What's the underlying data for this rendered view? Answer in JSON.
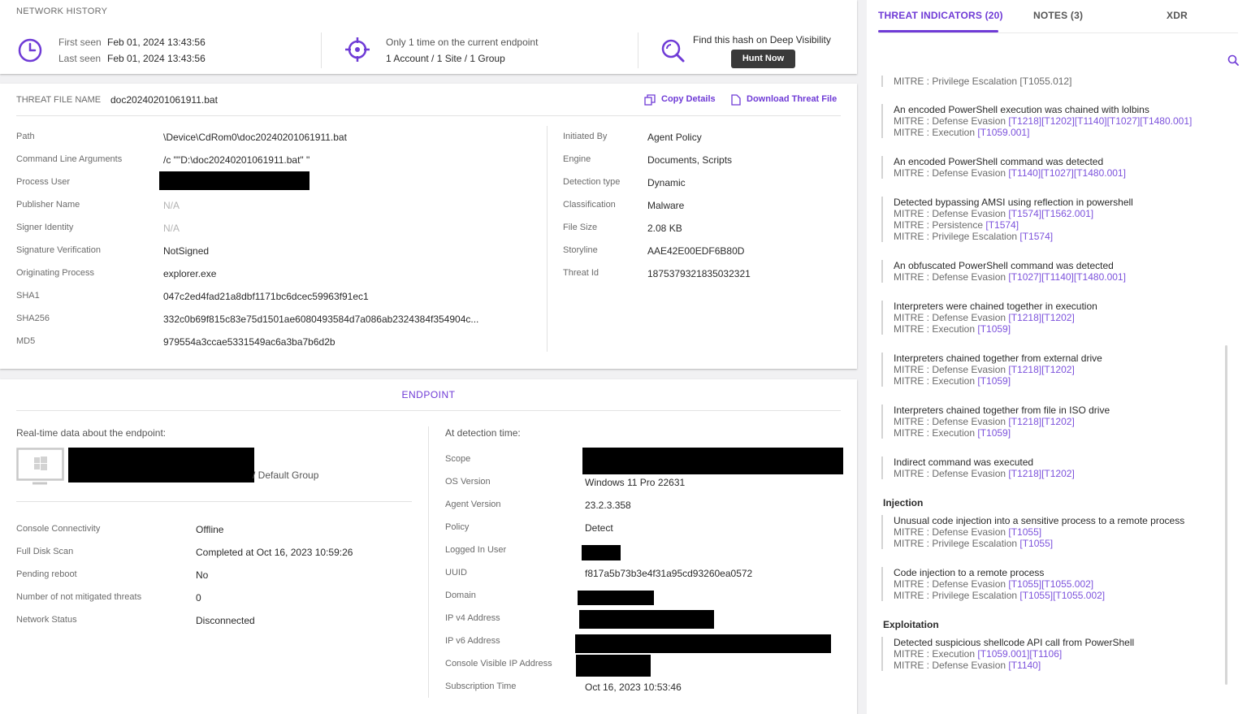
{
  "network_history": {
    "title": "NETWORK HISTORY",
    "first_seen_label": "First seen",
    "first_seen_value": "Feb 01, 2024 13:43:56",
    "last_seen_label": "Last seen",
    "last_seen_value": "Feb 01, 2024 13:43:56",
    "endpoint_line": "Only 1 time on the current endpoint",
    "scope_line": "1 Account / 1 Site / 1 Group",
    "deep_visibility_text": "Find this hash on Deep Visibility",
    "hunt_now_label": "Hunt Now"
  },
  "threat_file": {
    "name_label": "THREAT FILE NAME",
    "name_value": "doc20240201061911.bat",
    "copy_details_label": "Copy Details",
    "download_label": "Download Threat File",
    "left_fields": [
      {
        "label": "Path",
        "value": "\\Device\\CdRom0\\doc20240201061911.bat"
      },
      {
        "label": "Command Line Arguments",
        "value": "/c \"\"D:\\doc20240201061911.bat\" \""
      },
      {
        "label": "Process User",
        "value": ""
      },
      {
        "label": "Publisher Name",
        "value": "N/A"
      },
      {
        "label": "Signer Identity",
        "value": "N/A"
      },
      {
        "label": "Signature Verification",
        "value": "NotSigned"
      },
      {
        "label": "Originating Process",
        "value": "explorer.exe"
      },
      {
        "label": "SHA1",
        "value": "047c2ed4fad21a8dbf1171bc6dcec59963f91ec1"
      },
      {
        "label": "SHA256",
        "value": "332c0b69f815c83e75d1501ae6080493584d7a086ab2324384f354904c..."
      },
      {
        "label": "MD5",
        "value": "979554a3ccae5331549ac6a3ba7b6d2b"
      }
    ],
    "right_fields": [
      {
        "label": "Initiated By",
        "value": "Agent Policy"
      },
      {
        "label": "Engine",
        "value": "Documents, Scripts"
      },
      {
        "label": "Detection type",
        "value": "Dynamic"
      },
      {
        "label": "Classification",
        "value": "Malware"
      },
      {
        "label": "File Size",
        "value": "2.08 KB"
      },
      {
        "label": "Storyline",
        "value": "AAE42E00EDF6B80D"
      },
      {
        "label": "Threat Id",
        "value": "1875379321835032321"
      }
    ]
  },
  "endpoint": {
    "title": "ENDPOINT",
    "realtime_label": "Real-time data about the endpoint:",
    "group_suffix": "/ Default Group",
    "left_fields": [
      {
        "label": "Console Connectivity",
        "value": "Offline"
      },
      {
        "label": "Full Disk Scan",
        "value": "Completed at Oct 16, 2023 10:59:26"
      },
      {
        "label": "Pending reboot",
        "value": "No"
      },
      {
        "label": "Number of not mitigated threats",
        "value": "0"
      },
      {
        "label": "Network Status",
        "value": "Disconnected"
      }
    ],
    "detection_label": "At detection time:",
    "right_fields": [
      {
        "label": "Scope",
        "value": ""
      },
      {
        "label": "OS Version",
        "value": "Windows 11 Pro 22631"
      },
      {
        "label": "Agent Version",
        "value": "23.2.3.358"
      },
      {
        "label": "Policy",
        "value": "Detect"
      },
      {
        "label": "Logged In User",
        "value": ""
      },
      {
        "label": "UUID",
        "value": "f817a5b73b3e4f31a95cd93260ea0572"
      },
      {
        "label": "Domain",
        "value": ""
      },
      {
        "label": "IP v4 Address",
        "value": ""
      },
      {
        "label": "IP v6 Address",
        "value": ""
      },
      {
        "label": "Console Visible IP Address",
        "value": ""
      },
      {
        "label": "Subscription Time",
        "value": "Oct 16, 2023 10:53:46"
      }
    ]
  },
  "right_panel": {
    "tabs": [
      "THREAT INDICATORS (20)",
      "NOTES (3)",
      "XDR"
    ],
    "clipped_line": "MITRE : Privilege Escalation [T1055.012]",
    "indicators": [
      {
        "title": "An encoded PowerShell execution was chained with lolbins",
        "mitre": [
          {
            "tactic": "MITRE : Defense Evasion ",
            "techs": "[T1218][T1202][T1140][T1027][T1480.001]"
          },
          {
            "tactic": "MITRE : Execution ",
            "techs": "[T1059.001]"
          }
        ]
      },
      {
        "title": "An encoded PowerShell command was detected",
        "mitre": [
          {
            "tactic": "MITRE : Defense Evasion ",
            "techs": "[T1140][T1027][T1480.001]"
          }
        ]
      },
      {
        "title": "Detected bypassing AMSI using reflection in powershell",
        "mitre": [
          {
            "tactic": "MITRE : Defense Evasion ",
            "techs": "[T1574][T1562.001]"
          },
          {
            "tactic": "MITRE : Persistence ",
            "techs": "[T1574]"
          },
          {
            "tactic": "MITRE : Privilege Escalation ",
            "techs": "[T1574]"
          }
        ]
      },
      {
        "title": "An obfuscated PowerShell command was detected",
        "mitre": [
          {
            "tactic": "MITRE : Defense Evasion ",
            "techs": "[T1027][T1140][T1480.001]"
          }
        ]
      },
      {
        "title": "Interpreters were chained together in execution",
        "mitre": [
          {
            "tactic": "MITRE : Defense Evasion ",
            "techs": "[T1218][T1202]"
          },
          {
            "tactic": "MITRE : Execution ",
            "techs": "[T1059]"
          }
        ]
      },
      {
        "title": "Interpreters chained together from external drive",
        "mitre": [
          {
            "tactic": "MITRE : Defense Evasion ",
            "techs": "[T1218][T1202]"
          },
          {
            "tactic": "MITRE : Execution ",
            "techs": "[T1059]"
          }
        ]
      },
      {
        "title": "Interpreters chained together from file in ISO drive",
        "mitre": [
          {
            "tactic": "MITRE : Defense Evasion ",
            "techs": "[T1218][T1202]"
          },
          {
            "tactic": "MITRE : Execution ",
            "techs": "[T1059]"
          }
        ]
      },
      {
        "title": "Indirect command was executed",
        "mitre": [
          {
            "tactic": "MITRE : Defense Evasion ",
            "techs": "[T1218][T1202]"
          }
        ]
      }
    ],
    "groups": [
      {
        "name": "Injection",
        "indicators": [
          {
            "title": "Unusual code injection into a sensitive process to a remote process",
            "mitre": [
              {
                "tactic": "MITRE : Defense Evasion ",
                "techs": "[T1055]"
              },
              {
                "tactic": "MITRE : Privilege Escalation ",
                "techs": "[T1055]"
              }
            ]
          },
          {
            "title": "Code injection to a remote process",
            "mitre": [
              {
                "tactic": "MITRE : Defense Evasion ",
                "techs": "[T1055][T1055.002]"
              },
              {
                "tactic": "MITRE : Privilege Escalation ",
                "techs": "[T1055][T1055.002]"
              }
            ]
          }
        ]
      },
      {
        "name": "Exploitation",
        "indicators": [
          {
            "title": "Detected suspicious shellcode API call from PowerShell",
            "mitre": [
              {
                "tactic": "MITRE : Execution ",
                "techs": "[T1059.001][T1106]"
              },
              {
                "tactic": "MITRE : Defense Evasion ",
                "techs": "[T1140]"
              }
            ]
          }
        ]
      }
    ]
  },
  "colors": {
    "accent": "#6f3bd6",
    "background": "#f1f1f3"
  }
}
